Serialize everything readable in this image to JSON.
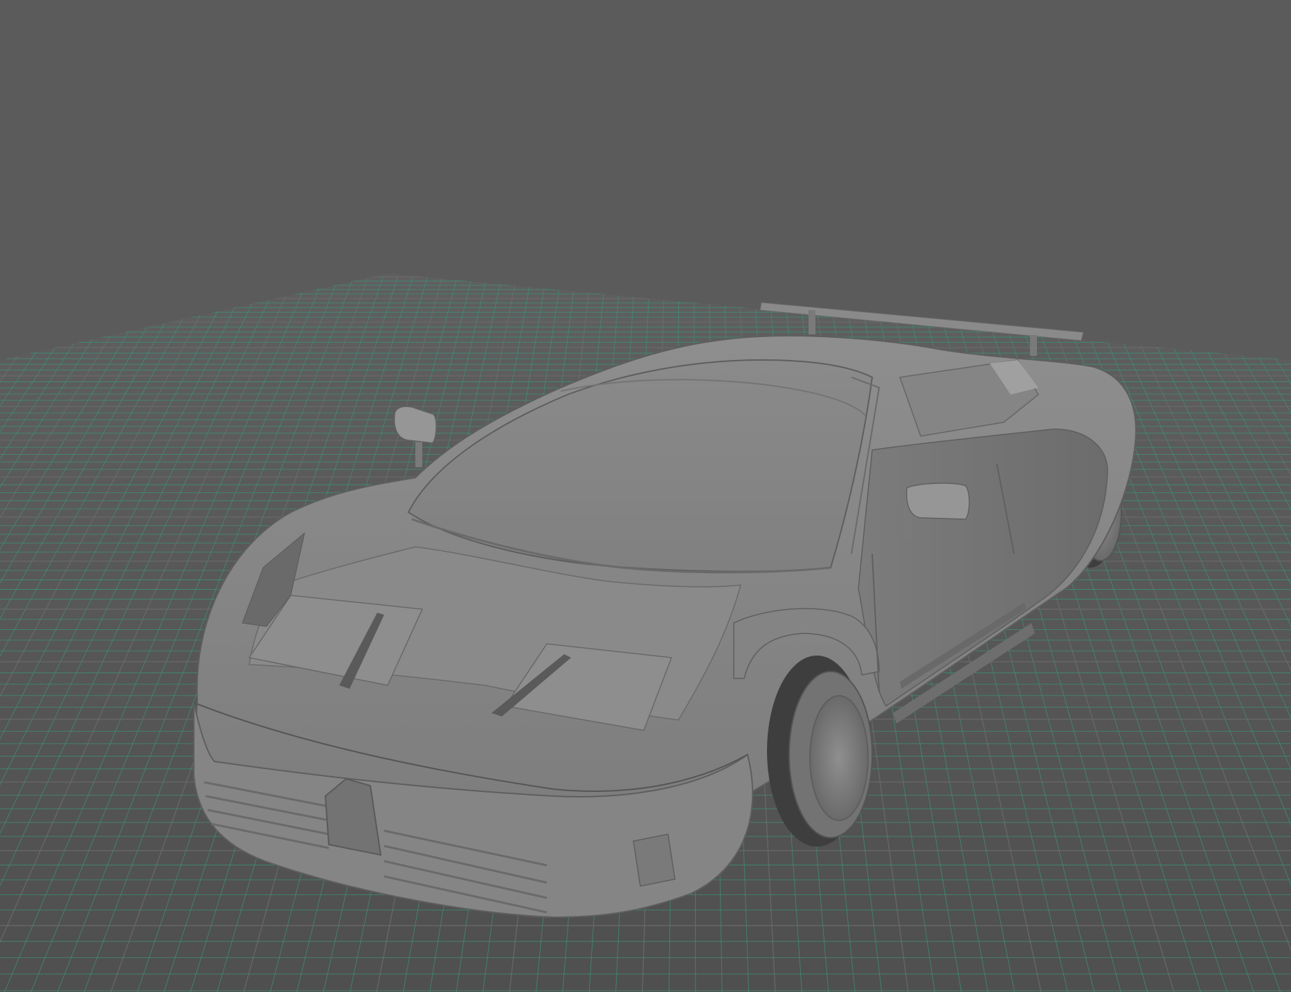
{
  "viewport": {
    "camera": "perspective",
    "shading": "smooth-shaded",
    "background_color": "#5b5b5b",
    "grid_visible": true,
    "grid_color": "#3f8f78",
    "grid_line_color": "#6a6a6a",
    "model_color": "#8c8c8c",
    "model_name": "sports-car"
  }
}
